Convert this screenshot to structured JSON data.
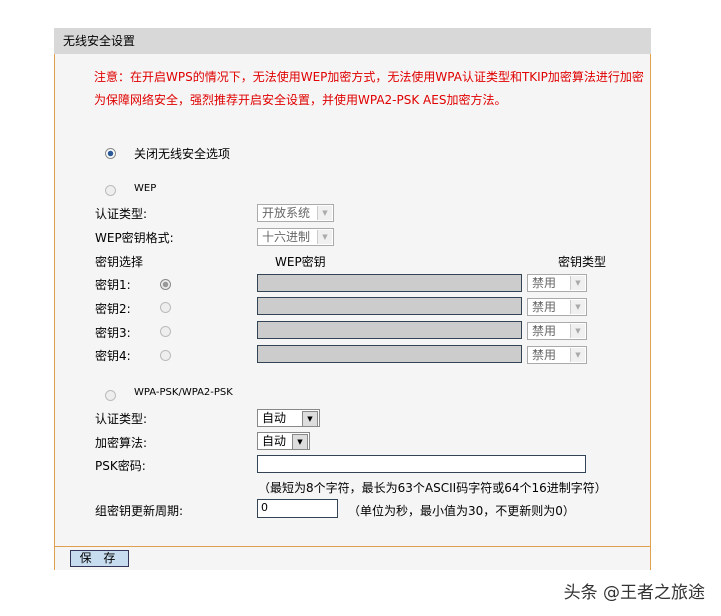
{
  "title": "无线安全设置",
  "notice": [
    "注意：在开启WPS的情况下，无法使用WEP加密方式，无法使用WPA认证类型和TKIP加密算法进行加密",
    "为保障网络安全，强烈推荐开启安全设置，并使用WPA2-PSK AES加密方法。"
  ],
  "disable_option": "关闭无线安全选项",
  "wep": {
    "label": "WEP",
    "auth_label": "认证类型:",
    "auth_value": "开放系统",
    "format_label": "WEP密钥格式:",
    "format_value": "十六进制",
    "key_select_label": "密钥选择",
    "key_col_label": "WEP密钥",
    "type_col_label": "密钥类型",
    "keys": [
      {
        "label": "密钥1:",
        "value": "",
        "type": "禁用"
      },
      {
        "label": "密钥2:",
        "value": "",
        "type": "禁用"
      },
      {
        "label": "密钥3:",
        "value": "",
        "type": "禁用"
      },
      {
        "label": "密钥4:",
        "value": "",
        "type": "禁用"
      }
    ]
  },
  "wpa": {
    "label": "WPA-PSK/WPA2-PSK",
    "auth_label": "认证类型:",
    "auth_value": "自动",
    "algo_label": "加密算法:",
    "algo_value": "自动",
    "psk_label": "PSK密码:",
    "psk_value": "",
    "psk_hint": "（最短为8个字符，最长为63个ASCII码字符或64个16进制字符）",
    "period_label": "组密钥更新周期:",
    "period_value": "0",
    "period_hint": "（单位为秒，最小值为30，不更新则为0）"
  },
  "save_label": "保 存",
  "watermark": "头条 @王者之旅途"
}
